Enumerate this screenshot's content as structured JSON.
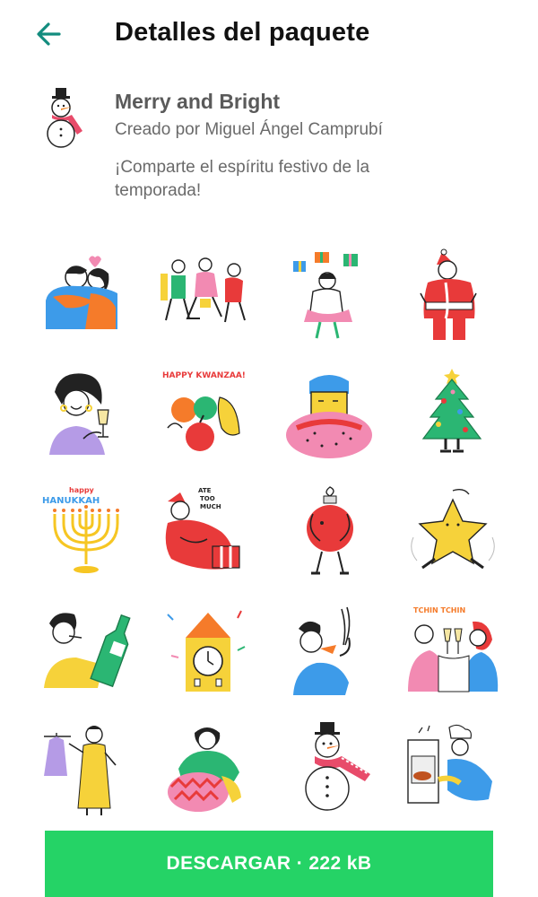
{
  "header": {
    "title": "Detalles del paquete",
    "back_icon": "arrow-back-icon"
  },
  "pack": {
    "name": "Merry and Bright",
    "author": "Creado por Miguel Ángel Camprubí",
    "description": "¡Comparte el espíritu festivo de la temporada!",
    "icon": "snowman-icon"
  },
  "stickers": {
    "s1": "hugging-couple-sticker",
    "s2": "dancing-group-sticker",
    "s3": "juggling-gifts-sticker",
    "s4": "santa-back-sticker",
    "s5": "woman-toasting-sticker",
    "s6": "kwanzaa-fruits-sticker",
    "s6_text": "HAPPY KWANZAA!",
    "s7": "bundled-scarf-person-sticker",
    "s8": "christmas-tree-sticker",
    "s9": "hanukkah-menorah-sticker",
    "s9_text_top": "happy",
    "s9_text_bottom": "HANUKKAH",
    "s10": "santa-ate-too-much-sticker",
    "s10_text": [
      "ATE",
      "TOO",
      "MUCH"
    ],
    "s11": "ornament-hug-sticker",
    "s12": "star-sticker",
    "s13": "champagne-bottle-sticker",
    "s14": "new-year-clock-sticker",
    "s15": "party-horn-sticker",
    "s16": "tchin-tchin-toast-sticker",
    "s16_text": "TCHIN TCHIN",
    "s17": "dress-shopping-sticker",
    "s18": "gift-wrapping-sticker",
    "s19": "snowman-sticker",
    "s20": "chef-oven-sticker"
  },
  "download": {
    "label": "DESCARGAR · 222 kB"
  },
  "colors": {
    "accent": "#25d366",
    "back_arrow": "#128c7e"
  }
}
